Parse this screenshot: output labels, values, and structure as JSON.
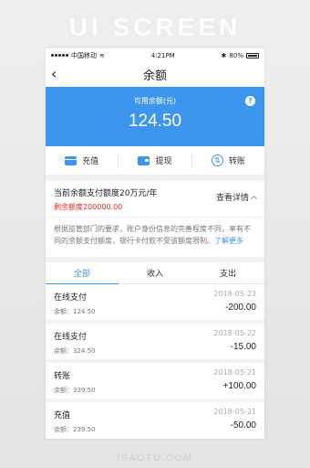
{
  "banner": {
    "title": "UI SCREEN",
    "watermark": "ISAOTU.COM"
  },
  "statusbar": {
    "carrier": "中国移动",
    "time": "4:21PM",
    "bluetooth": "✱",
    "battery": "80%"
  },
  "navbar": {
    "back_icon": "‹",
    "title": "余额"
  },
  "balance": {
    "label": "可用余额(元)",
    "amount": "124.50",
    "help": "?"
  },
  "actions": [
    {
      "label": "充值",
      "icon": "card-icon"
    },
    {
      "label": "提现",
      "icon": "wallet-icon"
    },
    {
      "label": "转账",
      "icon": "transfer-icon",
      "glyph": "⇅"
    }
  ],
  "limit": {
    "title": "当前余额支付额度20万元/年",
    "remaining": "剩余额度200000.00",
    "detail": "查看详情"
  },
  "notice": {
    "text": "根据监管部门的要求，账户身份信息的完善程度不同，享有不同的余额支付额度，银行卡付款不受该额度限制。",
    "more": "了解更多"
  },
  "tabs": [
    {
      "label": "全部",
      "active": true
    },
    {
      "label": "收入",
      "active": false
    },
    {
      "label": "支出",
      "active": false
    }
  ],
  "transactions": [
    {
      "title": "在线支付",
      "balance": "余额：124.50",
      "date": "2018-05-23",
      "amount": "-200.00"
    },
    {
      "title": "在线支付",
      "balance": "余额：324.50",
      "date": "2018-05-22",
      "amount": "-15.00"
    },
    {
      "title": "转账",
      "balance": "余额：339.50",
      "date": "2018-05-21",
      "amount": "+100.00"
    },
    {
      "title": "充值",
      "balance": "余额：239.50",
      "date": "2018-05-21",
      "amount": "-50.00"
    }
  ],
  "colors": {
    "accent": "#3d95ee",
    "warning": "#e02a2a"
  }
}
